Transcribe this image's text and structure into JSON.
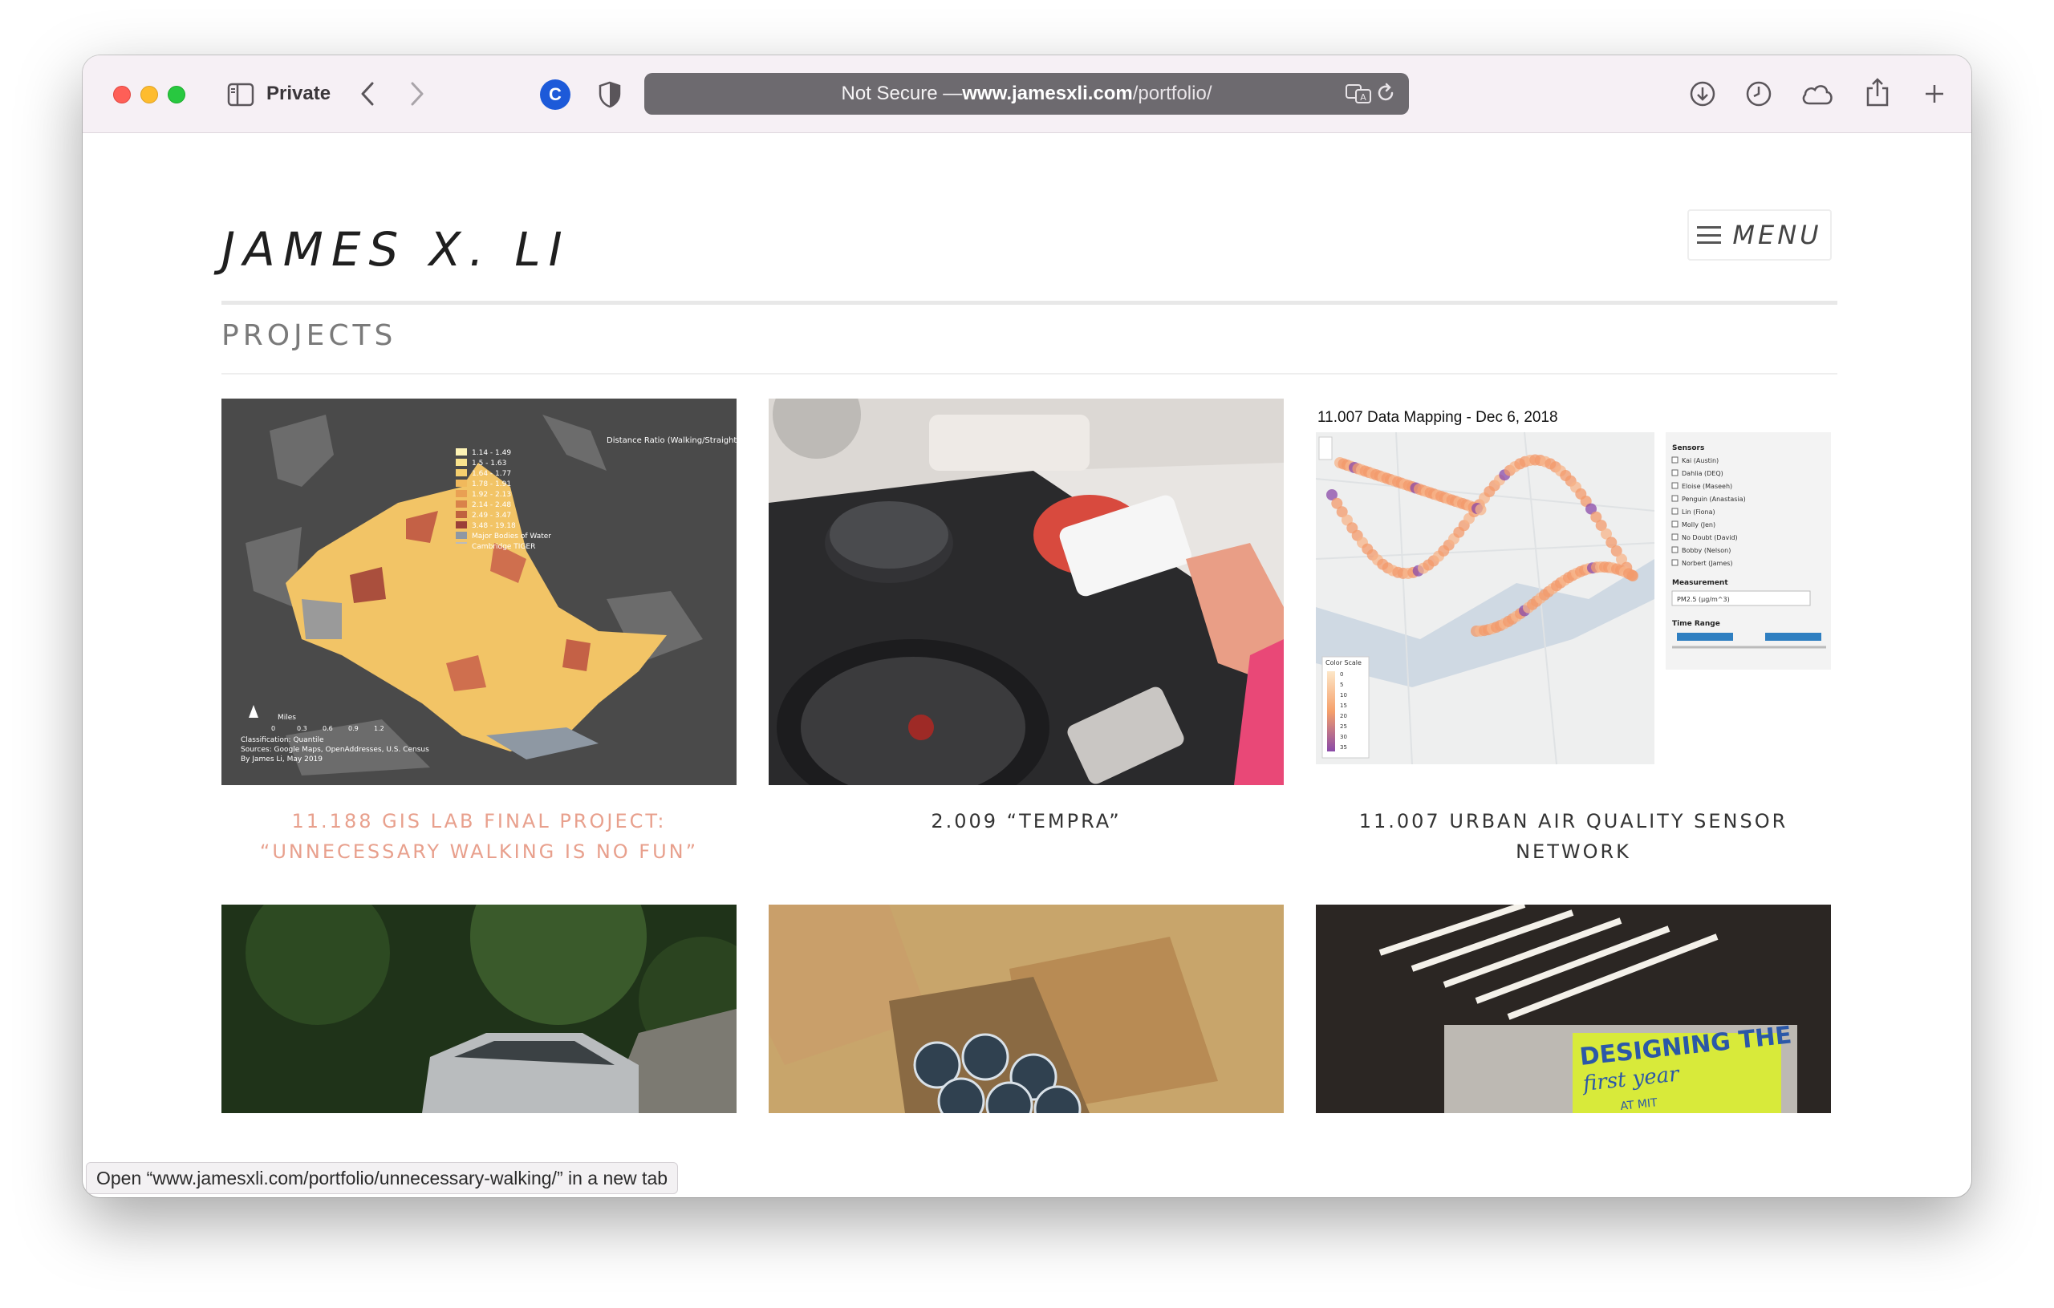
{
  "browser": {
    "mode_label": "Private",
    "extension_letter": "C",
    "address": {
      "prefix": "Not Secure — ",
      "domain": "www.jamesxli.com",
      "path": "/portfolio/"
    },
    "status_text": "Open “www.jamesxli.com/portfolio/unnecessary-walking/” in a new tab"
  },
  "site": {
    "title": "JAMES X. LI",
    "menu_label": "MENU",
    "section_title": "PROJECTS"
  },
  "projects": [
    {
      "title": "11.188 GIS LAB FINAL PROJECT: “UNNECESSARY WALKING IS NO FUN”",
      "hovered": true
    },
    {
      "title": "2.009 “TEMPRA”",
      "hovered": false
    },
    {
      "title": "11.007 URBAN AIR QUALITY SENSOR NETWORK",
      "hovered": false
    }
  ],
  "map_thumb": {
    "legend_title": "Distance Ratio (Walking/Straight-Line)",
    "legend_items": [
      "1.14 - 1.49",
      "1.5 - 1.63",
      "1.64 - 1.77",
      "1.78 - 1.91",
      "1.92 - 2.13",
      "2.14 - 2.48",
      "2.49 - 3.47",
      "3.48 - 19.18",
      "Major Bodies of Water",
      "Cambridge TIGER"
    ],
    "scale_label": "Miles",
    "scale_ticks": [
      "0",
      "0.3",
      "0.6",
      "0.9",
      "1.2"
    ],
    "credits": [
      "Classification: Quantile",
      "Sources: Google Maps, OpenAddresses, U.S. Census",
      "By James Li, May 2019"
    ]
  },
  "air_thumb": {
    "title": "11.007 Data Mapping - Dec 6, 2018",
    "sensors_label": "Sensors",
    "sensors": [
      "Kai (Austin)",
      "Dahlia (DEQ)",
      "Eloise (Maseeh)",
      "Penguin (Anastasia)",
      "Lin (Fiona)",
      "Molly (Jen)",
      "No Doubt (David)",
      "Bobby (Nelson)",
      "Norbert (James)"
    ],
    "measurement_label": "Measurement",
    "measurement_value": "PM2.5 (μg/m^3)",
    "time_label": "Time Range",
    "color_scale_label": "Color Scale",
    "color_scale_ticks": [
      "0",
      "5",
      "10",
      "15",
      "20",
      "25",
      "30",
      "35"
    ]
  },
  "screen_thumb": {
    "line1": "DESIGNING THE",
    "line2": "first year",
    "line3": "AT MIT"
  },
  "colors": {
    "hover_title": "#e8a08d",
    "map_bg": "#4a4a4a",
    "map_fill": "#f2c466"
  }
}
